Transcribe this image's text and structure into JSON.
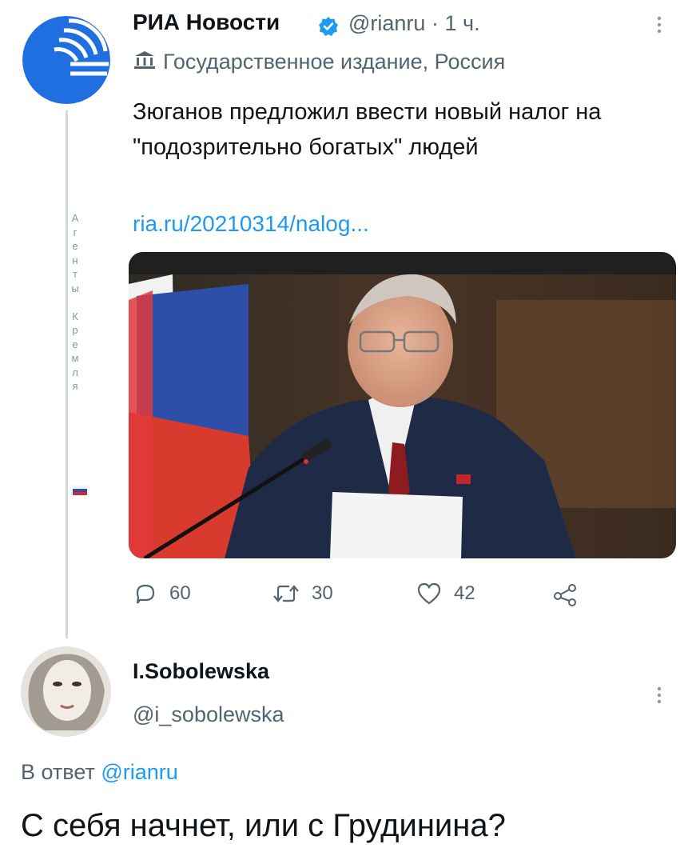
{
  "tweet": {
    "author_name": "РИА Новости",
    "handle": "@rianru",
    "separator": "·",
    "time": "1 ч.",
    "account_label": "Государственное издание, Россия",
    "text": "Зюганов предложил ввести новый налог на \"подозрительно богатых\" людей",
    "link": "ria.ru/20210314/nalog...",
    "sidebar_overlay": "А\nг\nе\nн\nт\nы\n\nК\nр\nе\nм\nл\nя",
    "actions": {
      "replies": "60",
      "retweets": "30",
      "likes": "42"
    },
    "colors": {
      "accent": "#1d9bf0",
      "secondary_text": "#536471",
      "logo_blue": "#1f6fe0"
    }
  },
  "reply": {
    "author_name": "I.Sobolewska",
    "handle": "@i_sobolewska",
    "reply_prefix": "В ответ",
    "reply_mention": "@rianru",
    "text": "С себя начнет, или с Грудинина?"
  },
  "icons": [
    "ria-logo-icon",
    "verified-badge-icon",
    "more-icon",
    "government-building-icon",
    "reply-icon",
    "retweet-icon",
    "like-icon",
    "share-icon",
    "russia-flag-icon"
  ]
}
